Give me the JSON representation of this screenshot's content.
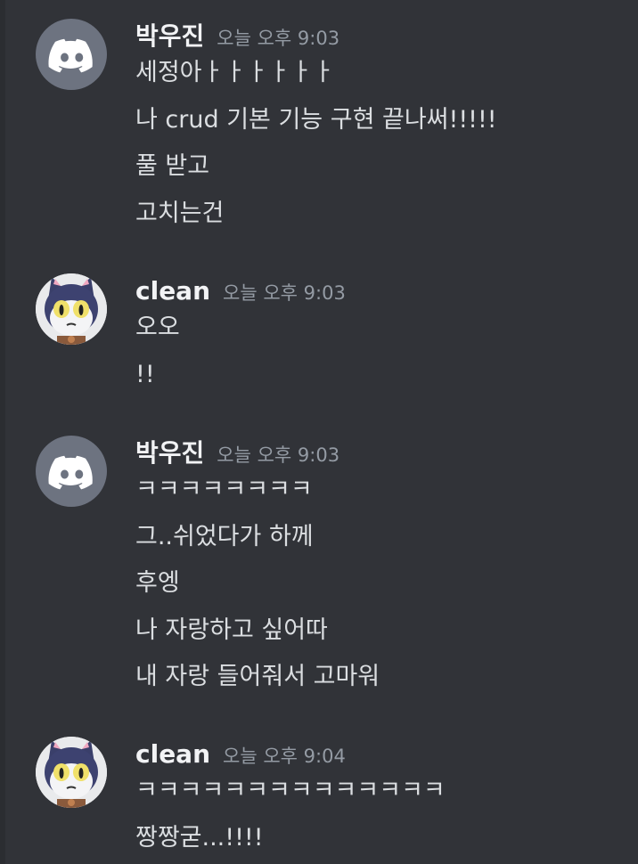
{
  "messages": [
    {
      "author": "박우진",
      "avatar": "discord-logo-avatar",
      "timestamp": "오늘 오후 9:03",
      "lines": [
        "세정아ㅏㅏㅏㅏㅏㅏ",
        "나 crud 기본 기능 구현 끝나써!!!!!",
        "풀 받고",
        "고치는건"
      ]
    },
    {
      "author": "clean",
      "avatar": "cat-character-avatar",
      "timestamp": "오늘 오후 9:03",
      "lines": [
        "오오",
        "!!"
      ]
    },
    {
      "author": "박우진",
      "avatar": "discord-logo-avatar",
      "timestamp": "오늘 오후 9:03",
      "lines": [
        "ㅋㅋㅋㅋㅋㅋㅋㅋ",
        "그..쉬었다가 하께",
        "후엥",
        "나 자랑하고 싶어따",
        "내 자랑 들어줘서 고마워"
      ]
    },
    {
      "author": "clean",
      "avatar": "cat-character-avatar",
      "timestamp": "오늘 오후 9:04",
      "lines": [
        "ㅋㅋㅋㅋㅋㅋㅋㅋㅋㅋㅋㅋㅋㅋ",
        "짱짱굳...!!!!"
      ]
    }
  ],
  "colors": {
    "background": "#313338",
    "username": "#f2f3f5",
    "message_text": "#dbdee1",
    "timestamp": "#949ba4",
    "discord_avatar_bg": "#6d7380"
  }
}
